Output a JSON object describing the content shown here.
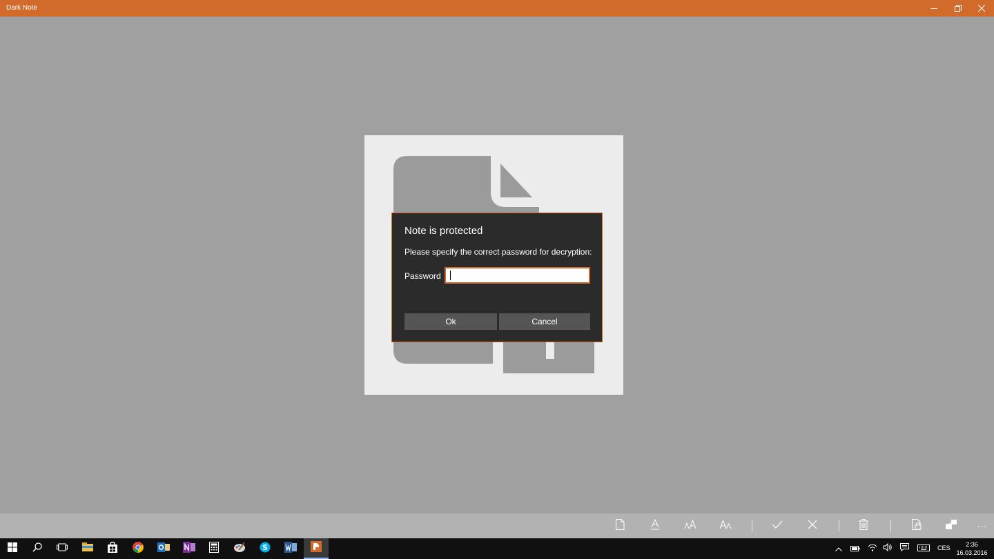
{
  "window": {
    "title": "Dark Note",
    "accent_color": "#d16a2b",
    "controls": [
      "minimize-icon",
      "restore-icon",
      "close-icon"
    ]
  },
  "dialog": {
    "title": "Note is protected",
    "message": "Please specify the correct password for decryption:",
    "password_label": "Password",
    "password_value": "",
    "ok_label": "Ok",
    "cancel_label": "Cancel"
  },
  "appbar": {
    "buttons": [
      "new-note-icon",
      "font-icon",
      "font-size-increase-icon",
      "font-size-decrease-icon",
      "save-check-icon",
      "discard-close-icon",
      "delete-trash-icon",
      "lock-note-icon",
      "share-icon"
    ],
    "more_label": "···"
  },
  "taskbar": {
    "apps": [
      "start-icon",
      "search-icon",
      "task-view-icon",
      "file-explorer-icon",
      "store-icon",
      "chrome-icon",
      "outlook-icon",
      "onenote-icon",
      "calculator-icon",
      "paint-icon",
      "skype-icon",
      "word-icon",
      "dark-note-icon"
    ],
    "tray": {
      "language": "CES",
      "time": "2:36",
      "date": "16.03.2016"
    }
  }
}
